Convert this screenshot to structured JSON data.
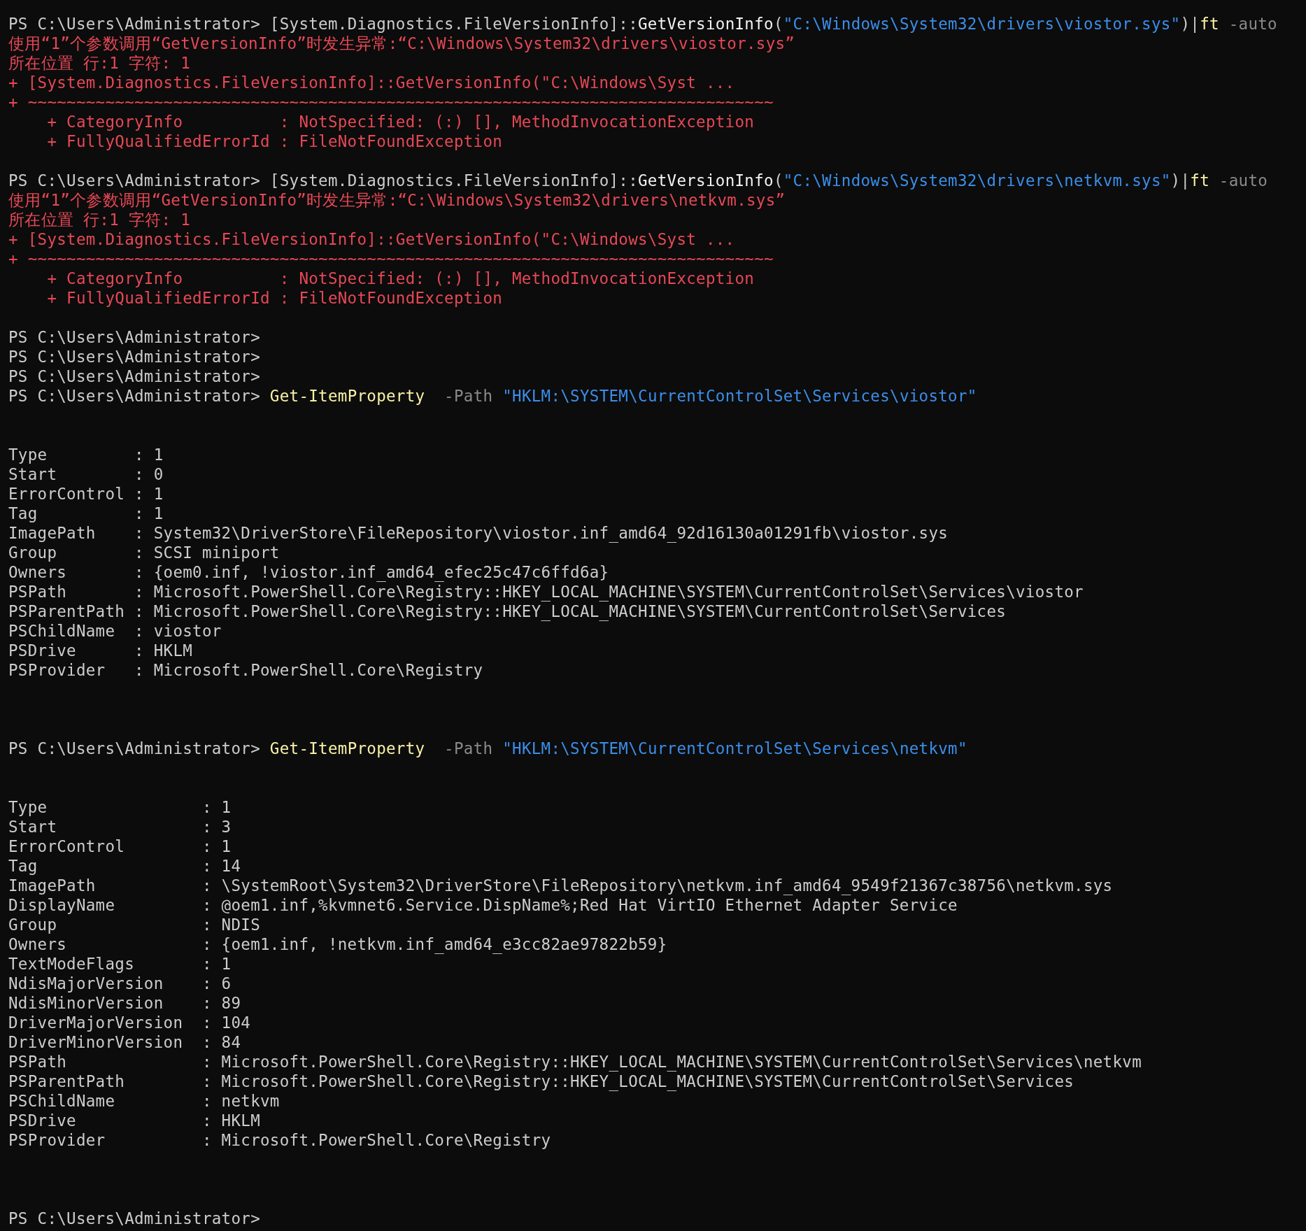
{
  "terminal": {
    "lines": [
      {
        "kind": "text",
        "segments": [
          {
            "kind": "prompt",
            "text": "PS C:\\Users\\Administrator> "
          },
          {
            "kind": "plain",
            "text": "[System.Diagnostics.FileVersionInfo]::"
          },
          {
            "kind": "method",
            "text": "GetVersionInfo"
          },
          {
            "kind": "plain",
            "text": "("
          },
          {
            "kind": "string",
            "text": "\"C:\\Windows\\System32\\drivers\\viostor.sys\""
          },
          {
            "kind": "plain",
            "text": ")|"
          },
          {
            "kind": "command",
            "text": "ft"
          },
          {
            "kind": "param",
            "text": " -auto"
          }
        ]
      },
      {
        "kind": "text",
        "segments": [
          {
            "kind": "error",
            "text": "使用“1”个参数调用“GetVersionInfo”时发生异常:“C:\\Windows\\System32\\drivers\\viostor.sys”"
          }
        ]
      },
      {
        "kind": "text",
        "segments": [
          {
            "kind": "error",
            "text": "所在位置 行:1 字符: 1"
          }
        ]
      },
      {
        "kind": "text",
        "segments": [
          {
            "kind": "error",
            "text": "+ [System.Diagnostics.FileVersionInfo]::GetVersionInfo(\"C:\\Windows\\Syst ..."
          }
        ]
      },
      {
        "kind": "text",
        "segments": [
          {
            "kind": "error",
            "text": "+ ~~~~~~~~~~~~~~~~~~~~~~~~~~~~~~~~~~~~~~~~~~~~~~~~~~~~~~~~~~~~~~~~~~~~~~~~~~~~~"
          }
        ]
      },
      {
        "kind": "text",
        "segments": [
          {
            "kind": "error",
            "text": "    + CategoryInfo          : NotSpecified: (:) [], MethodInvocationException"
          }
        ]
      },
      {
        "kind": "text",
        "segments": [
          {
            "kind": "error",
            "text": "    + FullyQualifiedErrorId : FileNotFoundException"
          }
        ]
      },
      {
        "kind": "blank"
      },
      {
        "kind": "text",
        "segments": [
          {
            "kind": "prompt",
            "text": "PS C:\\Users\\Administrator> "
          },
          {
            "kind": "plain",
            "text": "[System.Diagnostics.FileVersionInfo]::"
          },
          {
            "kind": "method",
            "text": "GetVersionInfo"
          },
          {
            "kind": "plain",
            "text": "("
          },
          {
            "kind": "string",
            "text": "\"C:\\Windows\\System32\\drivers\\netkvm.sys\""
          },
          {
            "kind": "plain",
            "text": ")|"
          },
          {
            "kind": "command",
            "text": "ft"
          },
          {
            "kind": "param",
            "text": " -auto"
          }
        ]
      },
      {
        "kind": "text",
        "segments": [
          {
            "kind": "error",
            "text": "使用“1”个参数调用“GetVersionInfo”时发生异常:“C:\\Windows\\System32\\drivers\\netkvm.sys”"
          }
        ]
      },
      {
        "kind": "text",
        "segments": [
          {
            "kind": "error",
            "text": "所在位置 行:1 字符: 1"
          }
        ]
      },
      {
        "kind": "text",
        "segments": [
          {
            "kind": "error",
            "text": "+ [System.Diagnostics.FileVersionInfo]::GetVersionInfo(\"C:\\Windows\\Syst ..."
          }
        ]
      },
      {
        "kind": "text",
        "segments": [
          {
            "kind": "error",
            "text": "+ ~~~~~~~~~~~~~~~~~~~~~~~~~~~~~~~~~~~~~~~~~~~~~~~~~~~~~~~~~~~~~~~~~~~~~~~~~~~~~"
          }
        ]
      },
      {
        "kind": "text",
        "segments": [
          {
            "kind": "error",
            "text": "    + CategoryInfo          : NotSpecified: (:) [], MethodInvocationException"
          }
        ]
      },
      {
        "kind": "text",
        "segments": [
          {
            "kind": "error",
            "text": "    + FullyQualifiedErrorId : FileNotFoundException"
          }
        ]
      },
      {
        "kind": "blank"
      },
      {
        "kind": "text",
        "segments": [
          {
            "kind": "prompt",
            "text": "PS C:\\Users\\Administrator>"
          }
        ]
      },
      {
        "kind": "text",
        "segments": [
          {
            "kind": "prompt",
            "text": "PS C:\\Users\\Administrator>"
          }
        ]
      },
      {
        "kind": "text",
        "segments": [
          {
            "kind": "prompt",
            "text": "PS C:\\Users\\Administrator>"
          }
        ]
      },
      {
        "kind": "text",
        "segments": [
          {
            "kind": "prompt",
            "text": "PS C:\\Users\\Administrator> "
          },
          {
            "kind": "command",
            "text": "Get-ItemProperty"
          },
          {
            "kind": "param",
            "text": "  -Path "
          },
          {
            "kind": "string",
            "text": "\"HKLM:\\SYSTEM\\CurrentControlSet\\Services\\viostor\""
          }
        ]
      },
      {
        "kind": "blank"
      },
      {
        "kind": "blank"
      },
      {
        "kind": "text",
        "segments": [
          {
            "kind": "output",
            "text": "Type         : 1"
          }
        ]
      },
      {
        "kind": "text",
        "segments": [
          {
            "kind": "output",
            "text": "Start        : 0"
          }
        ]
      },
      {
        "kind": "text",
        "segments": [
          {
            "kind": "output",
            "text": "ErrorControl : 1"
          }
        ]
      },
      {
        "kind": "text",
        "segments": [
          {
            "kind": "output",
            "text": "Tag          : 1"
          }
        ]
      },
      {
        "kind": "text",
        "segments": [
          {
            "kind": "output",
            "text": "ImagePath    : System32\\DriverStore\\FileRepository\\viostor.inf_amd64_92d16130a01291fb\\viostor.sys"
          }
        ]
      },
      {
        "kind": "text",
        "segments": [
          {
            "kind": "output",
            "text": "Group        : SCSI miniport"
          }
        ]
      },
      {
        "kind": "text",
        "segments": [
          {
            "kind": "output",
            "text": "Owners       : {oem0.inf, !viostor.inf_amd64_efec25c47c6ffd6a}"
          }
        ]
      },
      {
        "kind": "text",
        "segments": [
          {
            "kind": "output",
            "text": "PSPath       : Microsoft.PowerShell.Core\\Registry::HKEY_LOCAL_MACHINE\\SYSTEM\\CurrentControlSet\\Services\\viostor"
          }
        ]
      },
      {
        "kind": "text",
        "segments": [
          {
            "kind": "output",
            "text": "PSParentPath : Microsoft.PowerShell.Core\\Registry::HKEY_LOCAL_MACHINE\\SYSTEM\\CurrentControlSet\\Services"
          }
        ]
      },
      {
        "kind": "text",
        "segments": [
          {
            "kind": "output",
            "text": "PSChildName  : viostor"
          }
        ]
      },
      {
        "kind": "text",
        "segments": [
          {
            "kind": "output",
            "text": "PSDrive      : HKLM"
          }
        ]
      },
      {
        "kind": "text",
        "segments": [
          {
            "kind": "output",
            "text": "PSProvider   : Microsoft.PowerShell.Core\\Registry"
          }
        ]
      },
      {
        "kind": "blank"
      },
      {
        "kind": "blank"
      },
      {
        "kind": "blank"
      },
      {
        "kind": "text",
        "segments": [
          {
            "kind": "prompt",
            "text": "PS C:\\Users\\Administrator> "
          },
          {
            "kind": "command",
            "text": "Get-ItemProperty"
          },
          {
            "kind": "param",
            "text": "  -Path "
          },
          {
            "kind": "string",
            "text": "\"HKLM:\\SYSTEM\\CurrentControlSet\\Services\\netkvm\""
          }
        ]
      },
      {
        "kind": "blank"
      },
      {
        "kind": "blank"
      },
      {
        "kind": "text",
        "segments": [
          {
            "kind": "output",
            "text": "Type                : 1"
          }
        ]
      },
      {
        "kind": "text",
        "segments": [
          {
            "kind": "output",
            "text": "Start               : 3"
          }
        ]
      },
      {
        "kind": "text",
        "segments": [
          {
            "kind": "output",
            "text": "ErrorControl        : 1"
          }
        ]
      },
      {
        "kind": "text",
        "segments": [
          {
            "kind": "output",
            "text": "Tag                 : 14"
          }
        ]
      },
      {
        "kind": "text",
        "segments": [
          {
            "kind": "output",
            "text": "ImagePath           : \\SystemRoot\\System32\\DriverStore\\FileRepository\\netkvm.inf_amd64_9549f21367c38756\\netkvm.sys"
          }
        ]
      },
      {
        "kind": "text",
        "segments": [
          {
            "kind": "output",
            "text": "DisplayName         : @oem1.inf,%kvmnet6.Service.DispName%;Red Hat VirtIO Ethernet Adapter Service"
          }
        ]
      },
      {
        "kind": "text",
        "segments": [
          {
            "kind": "output",
            "text": "Group               : NDIS"
          }
        ]
      },
      {
        "kind": "text",
        "segments": [
          {
            "kind": "output",
            "text": "Owners              : {oem1.inf, !netkvm.inf_amd64_e3cc82ae97822b59}"
          }
        ]
      },
      {
        "kind": "text",
        "segments": [
          {
            "kind": "output",
            "text": "TextModeFlags       : 1"
          }
        ]
      },
      {
        "kind": "text",
        "segments": [
          {
            "kind": "output",
            "text": "NdisMajorVersion    : 6"
          }
        ]
      },
      {
        "kind": "text",
        "segments": [
          {
            "kind": "output",
            "text": "NdisMinorVersion    : 89"
          }
        ]
      },
      {
        "kind": "text",
        "segments": [
          {
            "kind": "output",
            "text": "DriverMajorVersion  : 104"
          }
        ]
      },
      {
        "kind": "text",
        "segments": [
          {
            "kind": "output",
            "text": "DriverMinorVersion  : 84"
          }
        ]
      },
      {
        "kind": "text",
        "segments": [
          {
            "kind": "output",
            "text": "PSPath              : Microsoft.PowerShell.Core\\Registry::HKEY_LOCAL_MACHINE\\SYSTEM\\CurrentControlSet\\Services\\netkvm"
          }
        ]
      },
      {
        "kind": "text",
        "segments": [
          {
            "kind": "output",
            "text": "PSParentPath        : Microsoft.PowerShell.Core\\Registry::HKEY_LOCAL_MACHINE\\SYSTEM\\CurrentControlSet\\Services"
          }
        ]
      },
      {
        "kind": "text",
        "segments": [
          {
            "kind": "output",
            "text": "PSChildName         : netkvm"
          }
        ]
      },
      {
        "kind": "text",
        "segments": [
          {
            "kind": "output",
            "text": "PSDrive             : HKLM"
          }
        ]
      },
      {
        "kind": "text",
        "segments": [
          {
            "kind": "output",
            "text": "PSProvider          : Microsoft.PowerShell.Core\\Registry"
          }
        ]
      },
      {
        "kind": "blank"
      },
      {
        "kind": "blank"
      },
      {
        "kind": "blank"
      },
      {
        "kind": "text",
        "segments": [
          {
            "kind": "prompt",
            "text": "PS C:\\Users\\Administrator>"
          }
        ]
      }
    ]
  }
}
